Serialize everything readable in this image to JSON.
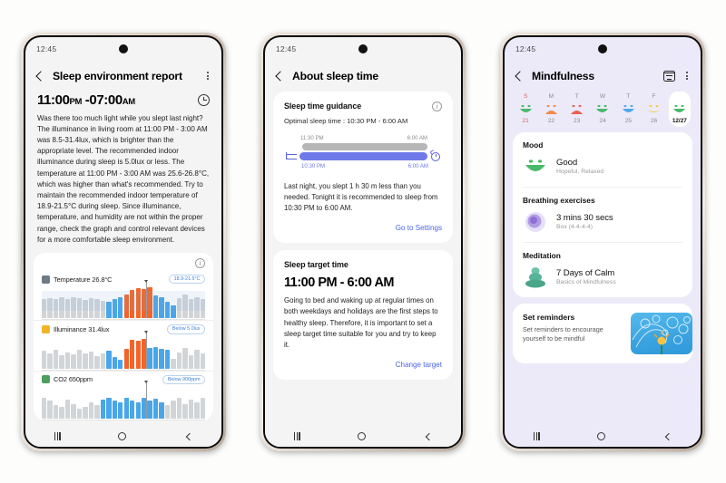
{
  "phones": [
    {
      "id": "sleep-environment-report",
      "status_time": "12:45",
      "appbar_title": "Sleep environment report",
      "sleep_range_start": "11:00",
      "sleep_range_start_period": "PM",
      "sleep_range_dash": "-",
      "sleep_range_end": "07:00",
      "sleep_range_end_period": "AM",
      "body_text": "Was there too much light while you slept last night? The illuminance in living room at 11:00 PM - 3:00 AM was 8.5-31.4lux, which is brighter than the appropriate level. The recommended indoor illuminance during sleep is 5.0lux or less. The temperature at 11:00 PM - 3:00 AM was 25.6-26.8°C, which was higher than what's recommended. Try to maintain the recommended indoor temperature of 18.9-21.5°C during sleep. Since illuminance, temperature, and humidity are not within the proper range, check the graph and control relevant devices for a more comfortable sleep environment.",
      "metrics": [
        {
          "name": "Temperature 26.8°C",
          "badge": "18.9-21.5°C",
          "icon": "thermometer-icon",
          "icon_color": "#6d7b86"
        },
        {
          "name": "Illuminance 31.4lux",
          "badge": "Below 5.0lux",
          "icon": "lightbulb-icon",
          "icon_color": "#f0b429"
        },
        {
          "name": "CO2 650ppm",
          "badge": "Below 900ppm",
          "icon": "co2-icon",
          "icon_color": "#4f9e5e"
        }
      ]
    },
    {
      "id": "about-sleep-time",
      "status_time": "12:45",
      "appbar_title": "About sleep time",
      "guidance_title": "Sleep time guidance",
      "guidance_sub": "Optimal sleep time : 10:30 PM - 6:00 AM",
      "timeline": {
        "gray_start": "11:30 PM",
        "gray_end": "6:00 AM",
        "blue_start": "10:30 PM",
        "blue_end": "6:00 AM"
      },
      "guidance_para": "Last night, you slept 1 h 30 m less than you needed. Tonight it is recommended to sleep from 10:30 PM to 6:00 AM.",
      "guidance_link": "Go to Settings",
      "target_title": "Sleep target time",
      "target_time": "11:00 PM - 6:00 AM",
      "target_para": "Going to bed and waking up at regular times on both weekdays and holidays are the first steps to healthy sleep. Therefore, it is important to set a sleep target time suitable for you and try to keep it.",
      "target_link": "Change target"
    },
    {
      "id": "mindfulness",
      "status_time": "12:45",
      "appbar_title": "Mindfulness",
      "week": [
        {
          "dow": "S",
          "date": "21",
          "mood": "happy",
          "color": "#49b96a",
          "sunday": true,
          "today": false
        },
        {
          "dow": "M",
          "date": "22",
          "mood": "sad",
          "color": "#f08a4b",
          "sunday": false,
          "today": false
        },
        {
          "dow": "T",
          "date": "23",
          "mood": "sad",
          "color": "#e8604f",
          "sunday": false,
          "today": false
        },
        {
          "dow": "W",
          "date": "24",
          "mood": "happy",
          "color": "#49b96a",
          "sunday": false,
          "today": false
        },
        {
          "dow": "T",
          "date": "25",
          "mood": "happy",
          "color": "#4ea8e8",
          "sunday": false,
          "today": false
        },
        {
          "dow": "F",
          "date": "26",
          "mood": "neutral",
          "color": "#f0cc4b",
          "sunday": false,
          "today": false
        },
        {
          "dow": "S",
          "date": "12/27",
          "mood": "happy",
          "color": "#49b96a",
          "sunday": false,
          "today": true
        }
      ],
      "sections": [
        {
          "title": "Mood",
          "main": "Good",
          "sub": "Hopeful, Relaxed",
          "thumb": "mood-face-icon"
        },
        {
          "title": "Breathing exercises",
          "main": "3 mins 30 secs",
          "sub": "Box (4-4-4-4)",
          "thumb": "breathing-orb-icon"
        },
        {
          "title": "Meditation",
          "main": "7 Days of Calm",
          "sub": "Basics of Mindfulness",
          "thumb": "meditation-figure-icon"
        }
      ],
      "reminder_title": "Set reminders",
      "reminder_sub": "Set reminders to encourage yourself to be mindful"
    }
  ],
  "navbar": {
    "recents": "recents-button",
    "home": "home-button",
    "back": "back-button"
  },
  "chart_data": [
    {
      "type": "bar",
      "title": "Temperature 26.8°C",
      "ylabel": "°C",
      "badge": "18.9-21.5°C",
      "values": [
        60,
        62,
        58,
        64,
        59,
        66,
        61,
        57,
        63,
        60,
        55,
        52,
        58,
        64,
        72,
        88,
        92,
        90,
        94,
        70,
        66,
        52,
        40,
        62,
        74,
        58,
        64,
        60
      ],
      "colors": [
        "g",
        "g",
        "g",
        "g",
        "g",
        "g",
        "g",
        "g",
        "g",
        "g",
        "g",
        "b",
        "b",
        "b",
        "o",
        "o",
        "o",
        "o",
        "o",
        "b",
        "b",
        "b",
        "b",
        "g",
        "g",
        "g",
        "g",
        "g"
      ]
    },
    {
      "type": "bar",
      "title": "Illuminance 31.4lux",
      "ylabel": "lux",
      "badge": "Below 5.0lux",
      "values": [
        54,
        46,
        58,
        40,
        50,
        44,
        56,
        46,
        52,
        38,
        46,
        54,
        36,
        26,
        60,
        88,
        86,
        90,
        62,
        64,
        60,
        58,
        30,
        48,
        62,
        40,
        56,
        46
      ],
      "colors": [
        "g",
        "g",
        "g",
        "g",
        "g",
        "g",
        "g",
        "g",
        "g",
        "g",
        "g",
        "b",
        "b",
        "b",
        "o",
        "o",
        "o",
        "o",
        "b",
        "b",
        "b",
        "b",
        "g",
        "g",
        "g",
        "g",
        "g",
        "g"
      ]
    },
    {
      "type": "bar",
      "title": "CO2 650ppm",
      "ylabel": "ppm",
      "badge": "Below 900ppm",
      "values": [
        62,
        54,
        40,
        36,
        58,
        44,
        30,
        34,
        50,
        42,
        58,
        62,
        56,
        48,
        64,
        56,
        50,
        62,
        54,
        60,
        48,
        40,
        56,
        62,
        44,
        58,
        50,
        62
      ],
      "colors": [
        "g",
        "g",
        "g",
        "g",
        "g",
        "g",
        "g",
        "g",
        "g",
        "g",
        "b",
        "b",
        "b",
        "b",
        "b",
        "b",
        "b",
        "b",
        "b",
        "b",
        "b",
        "g",
        "g",
        "g",
        "g",
        "g",
        "g",
        "g"
      ]
    }
  ]
}
